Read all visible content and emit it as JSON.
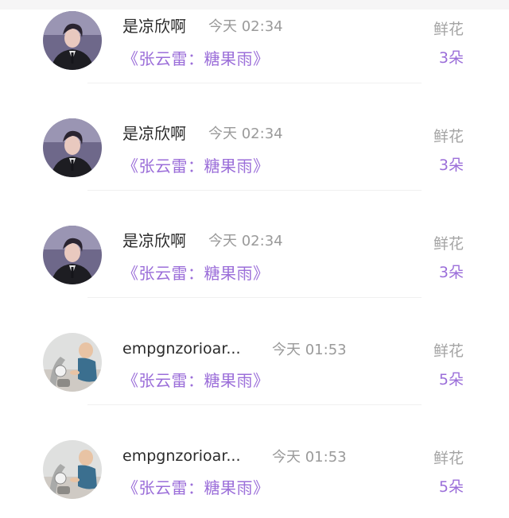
{
  "rows": [
    {
      "user": "是凉欣啊",
      "time": "今天 02:34",
      "book": "《张云雷：糖果雨》",
      "gift": "鲜花",
      "count": "3朵",
      "avatar": "portrait-avatar"
    },
    {
      "user": "是凉欣啊",
      "time": "今天 02:34",
      "book": "《张云雷：糖果雨》",
      "gift": "鲜花",
      "count": "3朵",
      "avatar": "portrait-avatar"
    },
    {
      "user": "是凉欣啊",
      "time": "今天 02:34",
      "book": "《张云雷：糖果雨》",
      "gift": "鲜花",
      "count": "3朵",
      "avatar": "portrait-avatar"
    },
    {
      "user": "empgnzorioar...",
      "time": "今天 01:53",
      "book": "《张云雷：糖果雨》",
      "gift": "鲜花",
      "count": "5朵",
      "avatar": "baby-avatar"
    },
    {
      "user": "empgnzorioar...",
      "time": "今天 01:53",
      "book": "《张云雷：糖果雨》",
      "gift": "鲜花",
      "count": "5朵",
      "avatar": "baby-avatar"
    }
  ],
  "colors": {
    "accent": "#9b6ed9",
    "muted": "#9a9a9a",
    "text": "#2b2b2b"
  }
}
